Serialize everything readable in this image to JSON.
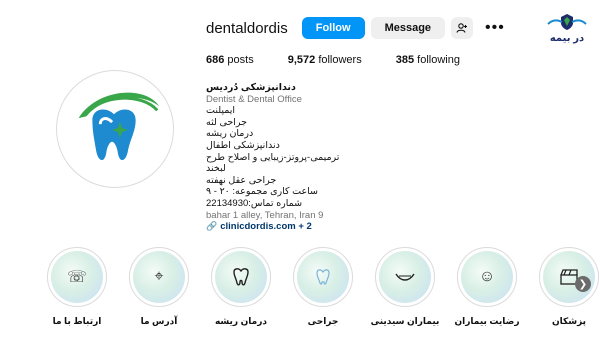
{
  "profile": {
    "username": "dentaldordis",
    "follow_label": "Follow",
    "message_label": "Message",
    "add_user_icon": "person-add-icon",
    "more_icon": "more-options-icon"
  },
  "stats": {
    "posts_count": "686",
    "posts_label": "posts",
    "followers_count": "9,572",
    "followers_label": "followers",
    "following_count": "385",
    "following_label": "following"
  },
  "bio": {
    "name": "دندانپزشکی دُردیس",
    "category": "Dentist & Dental Office",
    "lines": [
      "ایمپلنت",
      "جراحی لثه",
      "درمان ریشه",
      "دندانپزشکی اطفال",
      "ترمیمی-پروتز-زیبایی و اصلاح طرح لبخند",
      "جراحی عقل نهفته",
      "ساعت کاری مجموعه: ۲۰ - ۹",
      "شماره تماس:22134930"
    ],
    "location": "bahar 1 alley, Tehran, Iran 9",
    "link_text": "clinicdordis.com + 2",
    "link_icon": "link-icon"
  },
  "brand": {
    "text": "در بیمه",
    "icon": "insurance-logo-icon"
  },
  "highlights": [
    {
      "label": "ارتباط با ما",
      "icon": "phone-icon"
    },
    {
      "label": "آدرس ما",
      "icon": "map-pin-icon"
    },
    {
      "label": "درمان ریشه",
      "icon": "tooth-icon"
    },
    {
      "label": "جراحی",
      "icon": "tooth-outline-icon"
    },
    {
      "label": "بیماران سیدینی",
      "icon": "smile-icon"
    },
    {
      "label": "رضایت بیماران",
      "icon": "face-icon"
    },
    {
      "label": "پزشکان",
      "icon": "clapper-icon"
    }
  ],
  "next_icon": "chevron-right-icon",
  "colors": {
    "follow_bg": "#0095f6",
    "secondary_btn_bg": "#efefef",
    "link": "#00376b",
    "muted": "#737373",
    "brand_navy": "#1d2c6b",
    "brand_green": "#3aa64a",
    "brand_blue": "#1e8bd0"
  }
}
